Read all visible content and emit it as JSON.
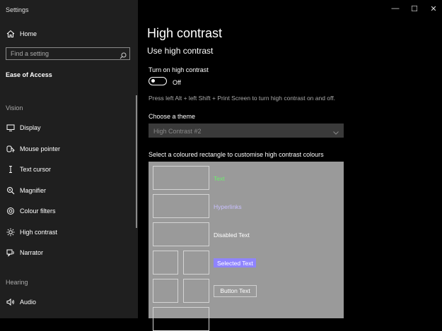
{
  "window": {
    "title": "Settings",
    "controls": {
      "minimize": "—",
      "maximize": "☐",
      "close": "✕"
    }
  },
  "sidebar": {
    "home_label": "Home",
    "search_placeholder": "Find a setting",
    "category": "Ease of Access",
    "group_vision": "Vision",
    "items": [
      {
        "label": "Display",
        "icon": "display-icon"
      },
      {
        "label": "Mouse pointer",
        "icon": "mouse-pointer-icon"
      },
      {
        "label": "Text cursor",
        "icon": "text-cursor-icon"
      },
      {
        "label": "Magnifier",
        "icon": "magnifier-icon"
      },
      {
        "label": "Colour filters",
        "icon": "colour-filters-icon"
      },
      {
        "label": "High contrast",
        "icon": "high-contrast-icon"
      },
      {
        "label": "Narrator",
        "icon": "narrator-icon"
      }
    ],
    "group_hearing": "Hearing",
    "hearing_items": [
      {
        "label": "Audio",
        "icon": "audio-icon"
      }
    ]
  },
  "main": {
    "title": "High contrast",
    "section_title": "Use high contrast",
    "toggle_label": "Turn on high contrast",
    "toggle_state": "Off",
    "toggle_on": false,
    "shortcut_hint": "Press left Alt + left Shift + Print Screen to turn high contrast on and off.",
    "theme_label": "Choose a theme",
    "theme_value": "High Contrast #2",
    "palette_instruction": "Select a coloured rectangle to customise high contrast colours",
    "palette": {
      "text": "Text",
      "hyperlinks": "Hyperlinks",
      "disabled_text": "Disabled Text",
      "selected_text": "Selected Text",
      "button_text": "Button Text",
      "colors": {
        "text": "#6bf06b",
        "hyperlinks": "#c9c0ff",
        "disabled_text": "#ffffff",
        "selected_bg": "#8f84ff",
        "background": "#9a9a9a"
      }
    }
  }
}
